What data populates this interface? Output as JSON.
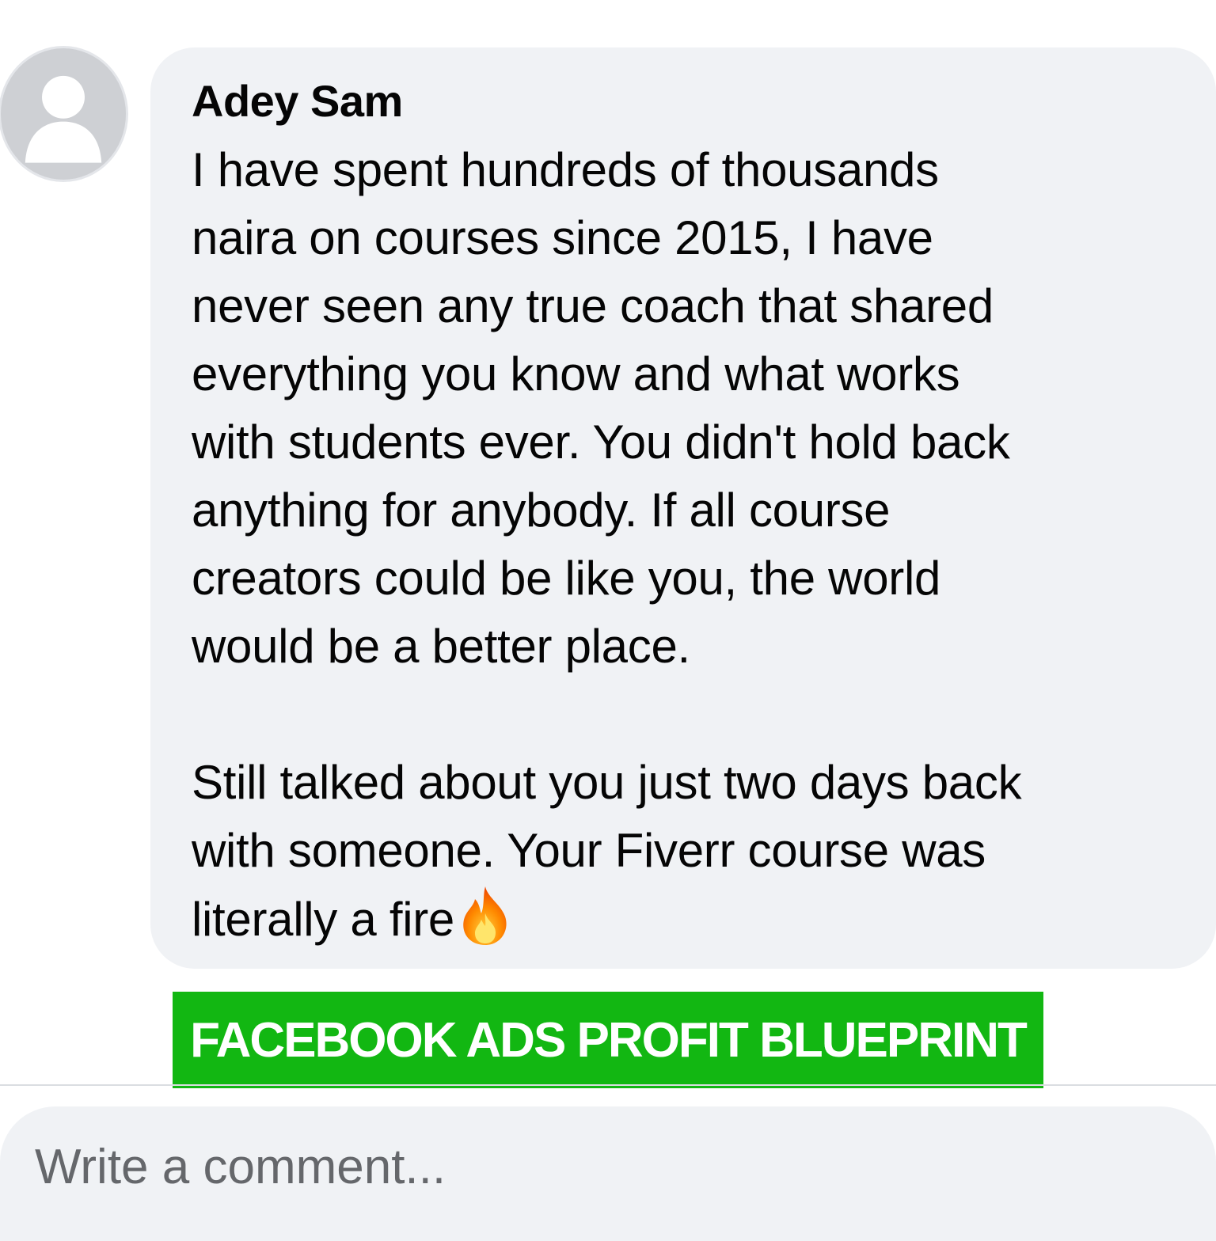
{
  "comment": {
    "author": "Adey Sam",
    "body": "I have spent hundreds of thousands\nnaira on courses since 2015, I have\nnever seen any true coach that shared\neverything you know and what works\nwith students ever. You didn't hold back\nanything for anybody. If all course\ncreators could be like you, the world\nwould be a better place.\n\nStill talked about you just two days back\nwith someone. Your Fiverr course was\nliterally a fire",
    "emoji_icon": "fire-emoji-icon",
    "avatar_icon": "default-profile-silhouette"
  },
  "banner": {
    "text": "FACEBOOK ADS PROFIT BLUEPRINT",
    "color": "#12b712"
  },
  "composer": {
    "placeholder": "Write a comment..."
  },
  "colors": {
    "bubble": "#f0f2f5",
    "text": "#050505",
    "placeholder": "#65676b"
  }
}
